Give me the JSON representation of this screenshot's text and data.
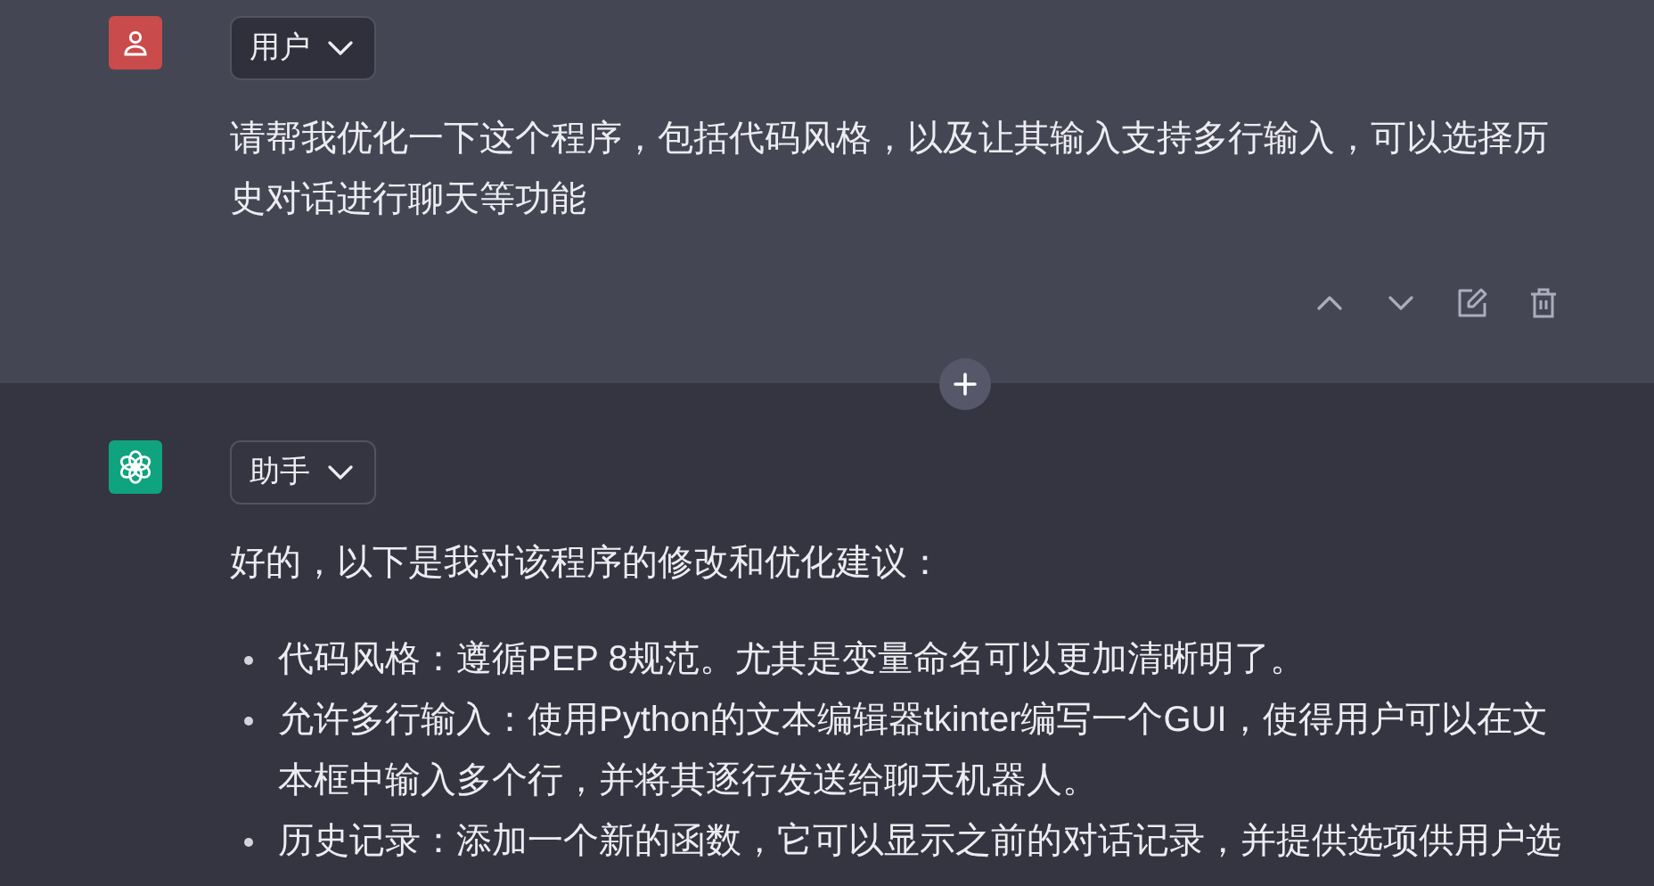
{
  "messages": [
    {
      "kind": "user",
      "role_label": "用户",
      "paragraphs": [
        "请帮我优化一下这个程序，包括代码风格，以及让其输入支持多行输入，可以选择历史对话进行聊天等功能"
      ]
    },
    {
      "kind": "assistant",
      "role_label": "助手",
      "paragraphs": [
        "好的，以下是我对该程序的修改和优化建议："
      ],
      "bullets": [
        "代码风格：遵循PEP 8规范。尤其是变量命名可以更加清晰明了。",
        "允许多行输入：使用Python的文本编辑器tkinter编写一个GUI，使得用户可以在文本框中输入多个行，并将其逐行发送给聊天机器人。",
        "历史记录：添加一个新的函数，它可以显示之前的对话记录，并提供选项供用户选"
      ]
    }
  ]
}
